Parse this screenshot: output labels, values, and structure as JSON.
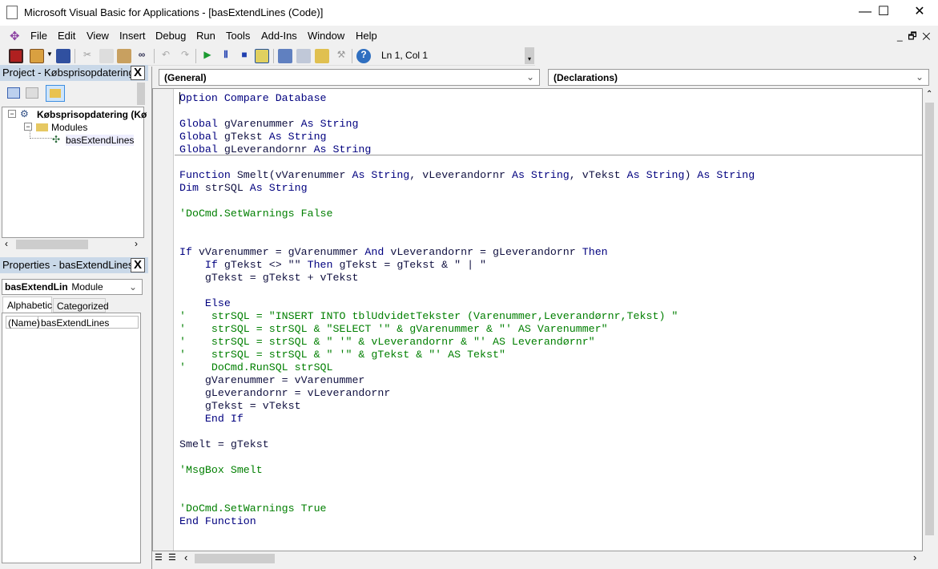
{
  "window": {
    "title": "Microsoft Visual Basic for Applications - [basExtendLines (Code)]",
    "minimize": "—",
    "maximize": "☐",
    "close": "✕"
  },
  "menu": [
    "File",
    "Edit",
    "View",
    "Insert",
    "Debug",
    "Run",
    "Tools",
    "Add-Ins",
    "Window",
    "Help"
  ],
  "toolbar": {
    "position": "Ln 1, Col 1"
  },
  "project": {
    "title": "Project - Købsprisopdatering",
    "close": "X",
    "root": "Købsprisopdatering (Kø",
    "folder": "Modules",
    "module": "basExtendLines"
  },
  "properties": {
    "title": "Properties - basExtendLines",
    "close": "X",
    "object_name": "basExtendLin",
    "object_type": "Module",
    "tabs": [
      "Alphabetic",
      "Categorized"
    ],
    "rows": [
      {
        "name": "(Name)",
        "value": "basExtendLines"
      }
    ]
  },
  "code_window": {
    "object_combo": "(General)",
    "proc_combo": "(Declarations)"
  },
  "colors": {
    "keyword": "#00007f",
    "comment": "#007f00",
    "text": "#101040"
  },
  "code_lines": [
    [
      [
        "kw",
        "Option Compare Database"
      ]
    ],
    [],
    [
      [
        "kw",
        "Global "
      ],
      [
        "tx",
        "gVarenummer "
      ],
      [
        "kw",
        "As String"
      ]
    ],
    [
      [
        "kw",
        "Global "
      ],
      [
        "tx",
        "gTekst "
      ],
      [
        "kw",
        "As String"
      ]
    ],
    [
      [
        "kw",
        "Global "
      ],
      [
        "tx",
        "gLeverandornr "
      ],
      [
        "kw",
        "As String"
      ]
    ],
    [],
    [
      [
        "kw",
        "Function "
      ],
      [
        "tx",
        "Smelt(vVarenummer "
      ],
      [
        "kw",
        "As String"
      ],
      [
        "tx",
        ", vLeverandornr "
      ],
      [
        "kw",
        "As String"
      ],
      [
        "tx",
        ", vTekst "
      ],
      [
        "kw",
        "As String"
      ],
      [
        "tx",
        ") "
      ],
      [
        "kw",
        "As String"
      ]
    ],
    [
      [
        "kw",
        "Dim "
      ],
      [
        "tx",
        "strSQL "
      ],
      [
        "kw",
        "As String"
      ]
    ],
    [],
    [
      [
        "cm",
        "'DoCmd.SetWarnings False"
      ]
    ],
    [],
    [],
    [
      [
        "kw",
        "If "
      ],
      [
        "tx",
        "vVarenummer = gVarenummer "
      ],
      [
        "kw",
        "And "
      ],
      [
        "tx",
        "vLeverandornr = gLeverandornr "
      ],
      [
        "kw",
        "Then"
      ]
    ],
    [
      [
        "kw",
        "    If "
      ],
      [
        "tx",
        "gTekst <> \"\" "
      ],
      [
        "kw",
        "Then "
      ],
      [
        "tx",
        "gTekst = gTekst & \" | \""
      ]
    ],
    [
      [
        "tx",
        "    gTekst = gTekst + vTekst"
      ]
    ],
    [],
    [
      [
        "kw",
        "    Else"
      ]
    ],
    [
      [
        "cm",
        "'    strSQL = \"INSERT INTO tblUdvidetTekster (Varenummer,Leverandørnr,Tekst) \""
      ]
    ],
    [
      [
        "cm",
        "'    strSQL = strSQL & \"SELECT '\" & gVarenummer & \"' AS Varenummer\""
      ]
    ],
    [
      [
        "cm",
        "'    strSQL = strSQL & \" '\" & vLeverandornr & \"' AS Leverandørnr\""
      ]
    ],
    [
      [
        "cm",
        "'    strSQL = strSQL & \" '\" & gTekst & \"' AS Tekst\""
      ]
    ],
    [
      [
        "cm",
        "'    DoCmd.RunSQL strSQL"
      ]
    ],
    [
      [
        "tx",
        "    gVarenummer = vVarenummer"
      ]
    ],
    [
      [
        "tx",
        "    gLeverandornr = vLeverandornr"
      ]
    ],
    [
      [
        "tx",
        "    gTekst = vTekst"
      ]
    ],
    [
      [
        "kw",
        "    End If"
      ]
    ],
    [],
    [
      [
        "tx",
        "Smelt = gTekst"
      ]
    ],
    [],
    [
      [
        "cm",
        "'MsgBox Smelt"
      ]
    ],
    [],
    [],
    [
      [
        "cm",
        "'DoCmd.SetWarnings True"
      ]
    ],
    [
      [
        "kw",
        "End Function"
      ]
    ]
  ]
}
